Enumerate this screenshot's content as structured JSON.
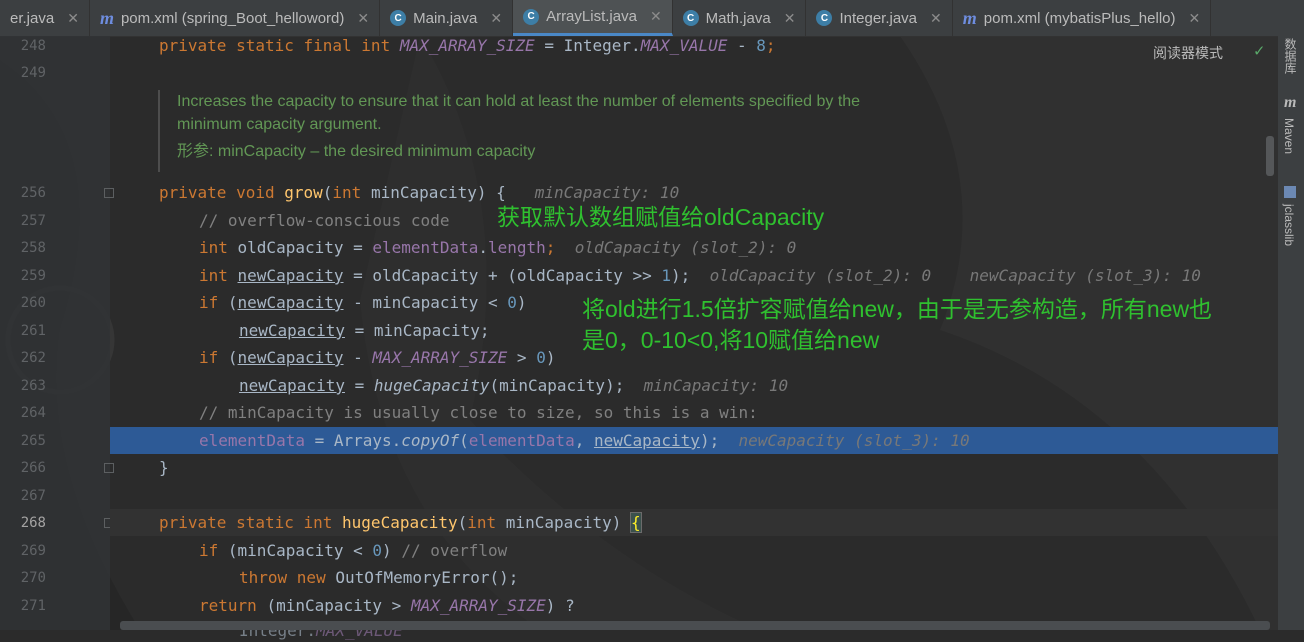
{
  "tabs": [
    {
      "label": "er.java",
      "icon": "",
      "active": false
    },
    {
      "label": "pom.xml (spring_Boot_helloword)",
      "icon": "m",
      "active": false
    },
    {
      "label": "Main.java",
      "icon": "c",
      "active": false
    },
    {
      "label": "ArrayList.java",
      "icon": "c",
      "active": true
    },
    {
      "label": "Math.java",
      "icon": "c",
      "active": false
    },
    {
      "label": "Integer.java",
      "icon": "c",
      "active": false
    },
    {
      "label": "pom.xml (mybatisPlus_hello)",
      "icon": "m",
      "active": false
    }
  ],
  "reader_mode": "阅读器模式",
  "right_tools": {
    "database": "数据库",
    "maven": "Maven",
    "jclasslib": "jclasslib"
  },
  "line_numbers": {
    "l248": "248",
    "l249": "249",
    "l256": "256",
    "l257": "257",
    "l258": "258",
    "l259": "259",
    "l260": "260",
    "l261": "261",
    "l262": "262",
    "l263": "263",
    "l264": "264",
    "l265": "265",
    "l266": "266",
    "l267": "267",
    "l268": "268",
    "l269": "269",
    "l270": "270",
    "l271": "271"
  },
  "doc": {
    "line1": "Increases the capacity to ensure that it can hold at least the number of elements specified by the",
    "line2": "minimum capacity argument.",
    "param_label": "形参:",
    "param_text": " minCapacity – the desired minimum capacity"
  },
  "code": {
    "c248": {
      "a": "private static final ",
      "b": "int ",
      "c": "MAX_ARRAY_SIZE",
      "d": " = Integer.",
      "e": "MAX_VALUE",
      "f": " - ",
      "g": "8",
      "h": ";"
    },
    "c256": {
      "a": "private void ",
      "b": "grow",
      "c": "(",
      "d": "int ",
      "e": "minCapacity) {",
      "hint": "minCapacity: 10"
    },
    "c257": "// overflow-conscious code",
    "c258": {
      "a": "int ",
      "b": "oldCapacity = ",
      "c": "elementData",
      "d": ".",
      "e": "length",
      "f": ";",
      "hint": "oldCapacity (slot_2): 0"
    },
    "c259": {
      "a": "int ",
      "b": "newCapacity",
      "c": " = oldCapacity + (oldCapacity >> ",
      "d": "1",
      "e": ");",
      "hint1": "oldCapacity (slot_2): 0",
      "hint2": "newCapacity (slot_3): 10"
    },
    "c260": {
      "a": "if ",
      "b": "(",
      "c": "newCapacity",
      "d": " - minCapacity < ",
      "e": "0",
      "f": ")"
    },
    "c261": {
      "a": "newCapacity",
      "b": " = minCapacity;"
    },
    "c262": {
      "a": "if ",
      "b": "(",
      "c": "newCapacity",
      "d": " - ",
      "e": "MAX_ARRAY_SIZE",
      "f": " > ",
      "g": "0",
      "h": ")"
    },
    "c263": {
      "a": "newCapacity",
      "b": " = ",
      "c": "hugeCapacity",
      "d": "(minCapacity);",
      "hint": "minCapacity: 10"
    },
    "c264": "// minCapacity is usually close to size, so this is a win:",
    "c265": {
      "a": "elementData",
      "b": " = Arrays.",
      "c": "copyOf",
      "d": "(",
      "e": "elementData",
      "f": ", ",
      "g": "newCapacity",
      "h": ");",
      "hint": "newCapacity (slot_3): 10"
    },
    "c266": "}",
    "c268": {
      "a": "private static ",
      "b": "int ",
      "c": "hugeCapacity",
      "d": "(",
      "e": "int ",
      "f": "minCapacity) ",
      "g": "{"
    },
    "c269": {
      "a": "if ",
      "b": "(minCapacity < ",
      "c": "0",
      "d": ") ",
      "e": "// overflow"
    },
    "c270": {
      "a": "throw new ",
      "b": "OutOfMemoryError();"
    },
    "c271": {
      "a": "return ",
      "b": "(minCapacity > ",
      "c": "MAX_ARRAY_SIZE",
      "d": ") ?"
    },
    "c272": {
      "a": "Integer.",
      "b": "MAX_VALUE"
    }
  },
  "annotations": {
    "note1": "获取默认数组赋值给oldCapacity",
    "note2_line1": "将old进行1.5倍扩容赋值给new，由于是无参构造，所有new也",
    "note2_line2": "是0，0-10<0,将10赋值给new"
  }
}
